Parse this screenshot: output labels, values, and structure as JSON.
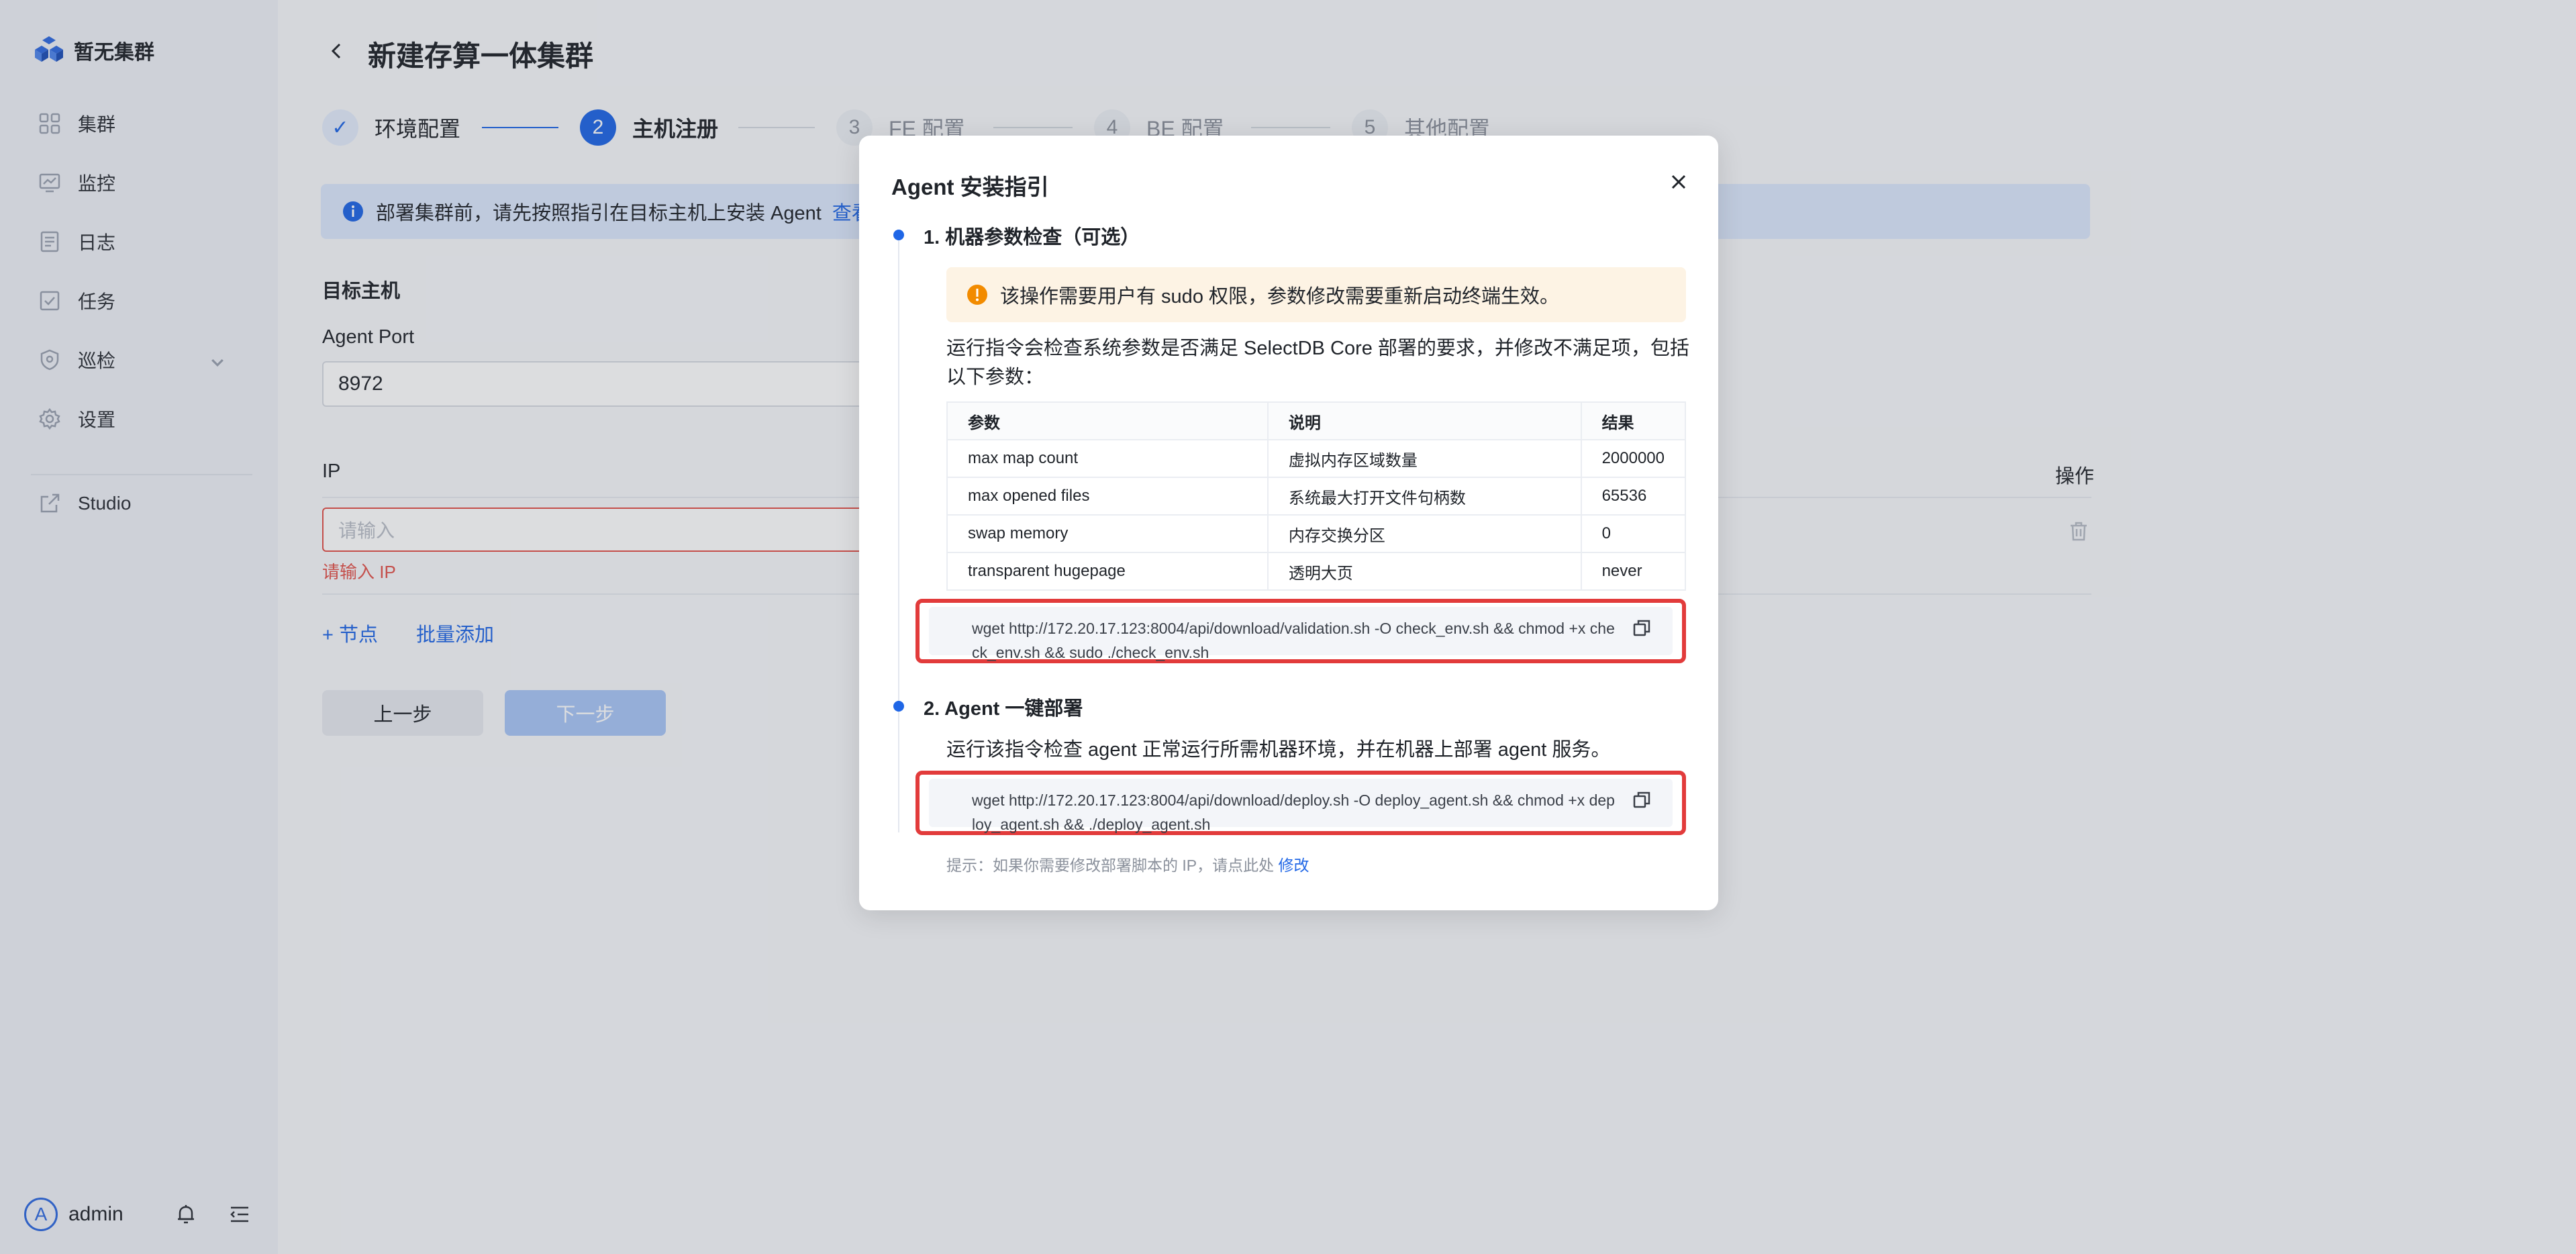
{
  "sidebar": {
    "brand": "暂无集群",
    "items": [
      {
        "label": "集群",
        "icon": "cluster-icon"
      },
      {
        "label": "监控",
        "icon": "monitor-icon"
      },
      {
        "label": "日志",
        "icon": "log-icon"
      },
      {
        "label": "任务",
        "icon": "task-icon"
      },
      {
        "label": "巡检",
        "icon": "inspection-icon"
      },
      {
        "label": "设置",
        "icon": "settings-icon"
      },
      {
        "label": "Studio",
        "icon": "external-link-icon"
      }
    ],
    "user": {
      "avatar_letter": "A",
      "name": "admin"
    }
  },
  "page": {
    "title": "新建存算一体集群",
    "steps": [
      {
        "number": "✓",
        "label": "环境配置",
        "state": "done"
      },
      {
        "number": "2",
        "label": "主机注册",
        "state": "active"
      },
      {
        "number": "3",
        "label": "FE 配置",
        "state": "todo"
      },
      {
        "number": "4",
        "label": "BE 配置",
        "state": "todo"
      },
      {
        "number": "5",
        "label": "其他配置",
        "state": "todo"
      }
    ],
    "info_text": "部署集群前，请先按照指引在目标主机上安装 Agent",
    "info_link": "查看",
    "target_host_label": "目标主机",
    "agent_port_label": "Agent Port",
    "agent_port_value": "8972",
    "ip_column": "IP",
    "action_column": "操作",
    "ip_placeholder": "请输入",
    "ip_error": "请输入 IP",
    "add_node": "+ 节点",
    "batch_add": "批量添加",
    "prev_button": "上一步",
    "next_button": "下一步"
  },
  "modal": {
    "title": "Agent 安装指引",
    "step1_title": "1. 机器参数检查（可选）",
    "warning": "该操作需要用户有 sudo 权限，参数修改需要重新启动终端生效。",
    "step1_desc": "运行指令会检查系统参数是否满足 SelectDB Core 部署的要求，并修改不满足项，包括以下参数：",
    "table": {
      "headers": [
        "参数",
        "说明",
        "结果"
      ],
      "rows": [
        [
          "max map count",
          "虚拟内存区域数量",
          "2000000"
        ],
        [
          "max opened files",
          "系统最大打开文件句柄数",
          "65536"
        ],
        [
          "swap memory",
          "内存交换分区",
          "0"
        ],
        [
          "transparent hugepage",
          "透明大页",
          "never"
        ]
      ]
    },
    "cmd1": "wget http://172.20.17.123:8004/api/download/validation.sh -O check_env.sh && chmod +x check_env.sh && sudo ./check_env.sh",
    "step2_title": "2. Agent 一键部署",
    "step2_desc": "运行该指令检查 agent 正常运行所需机器环境，并在机器上部署 agent 服务。",
    "cmd2": "wget http://172.20.17.123:8004/api/download/deploy.sh -O deploy_agent.sh && chmod +x deploy_agent.sh && ./deploy_agent.sh",
    "tip_text": "提示：如果你需要修改部署脚本的 IP，请点此处",
    "tip_link": "修改"
  },
  "colors": {
    "accent": "#1f66e6",
    "error": "#e2524b",
    "highlight_border": "#e23b3b",
    "warning": "#f28b00"
  }
}
